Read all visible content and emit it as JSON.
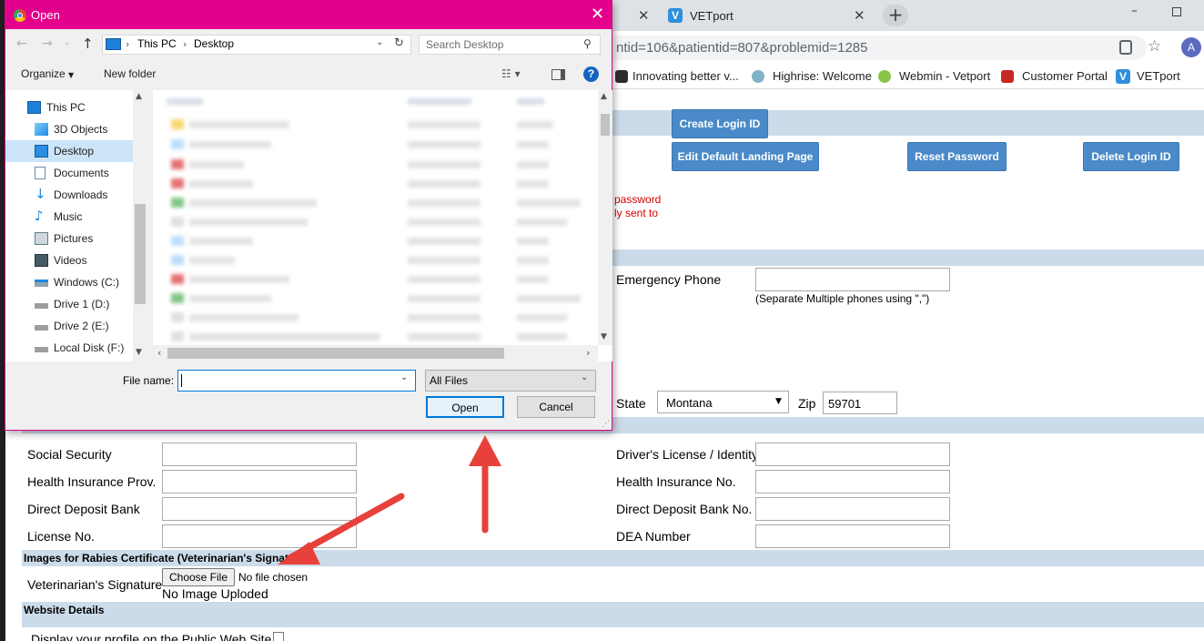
{
  "browser": {
    "vet_tab_title": "VETport",
    "url": "ntid=106&patientid=807&problemid=1285",
    "profile_initial": "A",
    "bookmarks": [
      "Innovating better v...",
      "Highrise: Welcome",
      "Webmin - Vetport",
      "Customer Portal",
      "VETport"
    ]
  },
  "page": {
    "buttons": {
      "create_login": "Create Login ID",
      "edit_landing": "Edit Default Landing Page",
      "reset_password": "Reset Password",
      "delete_login": "Delete Login ID"
    },
    "notice_line1": "password",
    "notice_line2": "ly sent to",
    "emergency_phone_label": "Emergency Phone",
    "phones_hint": "(Separate Multiple phones using \",\")",
    "state_label": "State",
    "state_value": "Montana",
    "zip_label": "Zip",
    "zip_value": "59701",
    "left_fields": [
      "Social Security",
      "Health Insurance Prov.",
      "Direct Deposit Bank",
      "License No."
    ],
    "right_fields": [
      "Driver's License / Identity",
      "Health Insurance No.",
      "Direct Deposit Bank No.",
      "DEA Number"
    ],
    "images_section": "Images for Rabies Certificate (Veterinarian's Signature)",
    "signature_label": "Veterinarian's Signature",
    "choose_file": "Choose File",
    "no_file": "No file chosen",
    "no_image": "No Image Uploded",
    "website_section": "Website Details",
    "display_profile": "Display your profile on the Public Web Site"
  },
  "dialog": {
    "title": "Open",
    "breadcrumb": [
      "This PC",
      "Desktop"
    ],
    "search_placeholder": "Search Desktop",
    "organize": "Organize",
    "new_folder": "New folder",
    "nav_items": [
      "This PC",
      "3D Objects",
      "Desktop",
      "Documents",
      "Downloads",
      "Music",
      "Pictures",
      "Videos",
      "Windows (C:)",
      "Drive 1 (D:)",
      "Drive 2 (E:)",
      "Local Disk (F:)"
    ],
    "file_name_label": "File name:",
    "file_name_value": "",
    "file_type": "All Files",
    "open_button": "Open",
    "cancel_button": "Cancel"
  }
}
